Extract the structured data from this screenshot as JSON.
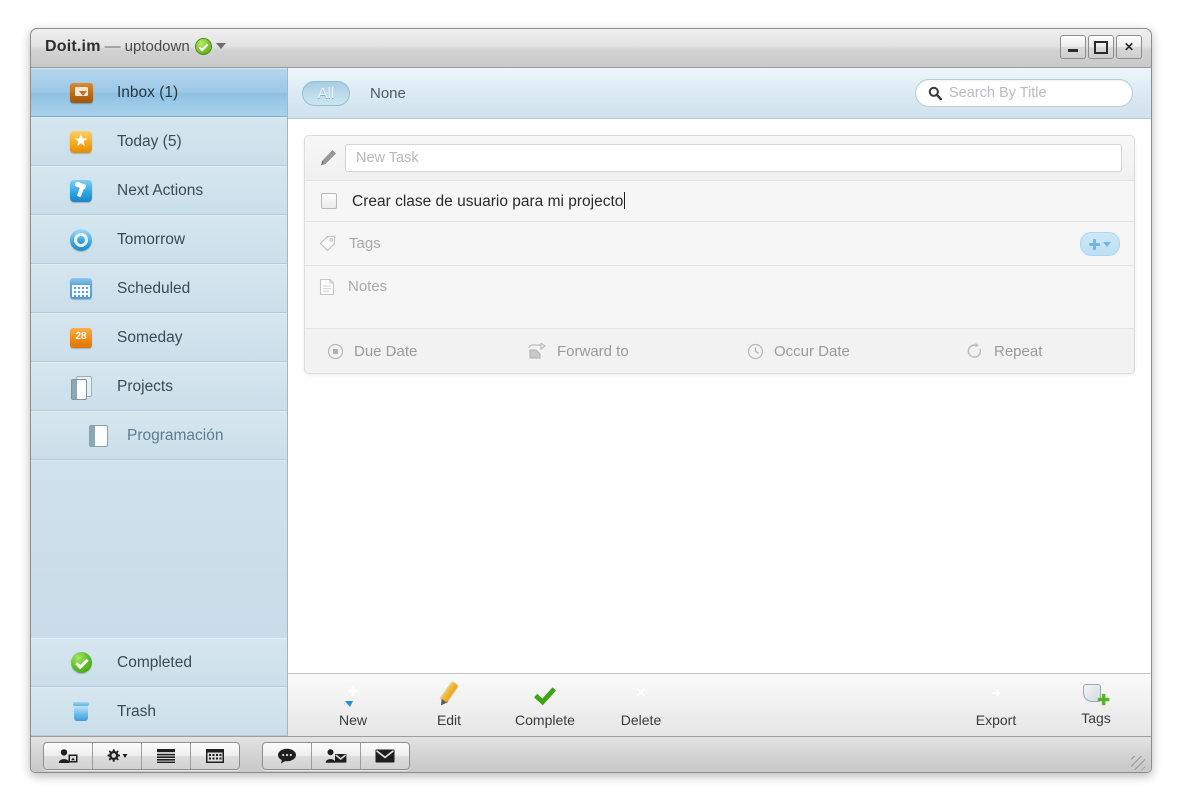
{
  "window": {
    "app_name": "Doit.im",
    "separator": "—",
    "account": "uptodown",
    "status_icon": "online-check-icon",
    "account_caret": "caret-down-icon",
    "controls": {
      "minimize": "minimize-icon",
      "maximize": "maximize-icon",
      "close": "✕"
    }
  },
  "sidebar": {
    "items": [
      {
        "label": "Inbox (1)",
        "icon": "inbox-icon",
        "selected": true
      },
      {
        "label": "Today (5)",
        "icon": "star-icon",
        "selected": false
      },
      {
        "label": "Next Actions",
        "icon": "pin-icon",
        "selected": false
      },
      {
        "label": "Tomorrow",
        "icon": "circle-icon",
        "selected": false
      },
      {
        "label": "Scheduled",
        "icon": "calendar-icon",
        "selected": false
      },
      {
        "label": "Someday",
        "icon": "folder-28-icon",
        "selected": false
      },
      {
        "label": "Projects",
        "icon": "projects-icon",
        "selected": false
      }
    ],
    "sub_items": [
      {
        "label": "Programación",
        "icon": "book-icon"
      }
    ],
    "bottom_items": [
      {
        "label": "Completed",
        "icon": "check-circle-icon"
      },
      {
        "label": "Trash",
        "icon": "trash-icon"
      }
    ]
  },
  "header": {
    "filters": [
      {
        "label": "All",
        "active": true
      },
      {
        "label": "None",
        "active": false
      }
    ],
    "search": {
      "icon": "search-icon",
      "placeholder": "Search By Title",
      "value": ""
    }
  },
  "editor": {
    "new_task": {
      "icon": "pencil-icon",
      "placeholder": "New Task",
      "value": ""
    },
    "task": {
      "checkbox_checked": false,
      "title": "Crear clase de usuario para mi projecto"
    },
    "tags": {
      "icon": "tag-icon",
      "label": "Tags",
      "add_button": "add-tag-button"
    },
    "notes": {
      "icon": "note-icon",
      "label": "Notes"
    },
    "meta": [
      {
        "label": "Due Date",
        "icon": "due-date-icon"
      },
      {
        "label": "Forward to",
        "icon": "forward-icon"
      },
      {
        "label": "Occur Date",
        "icon": "clock-icon"
      },
      {
        "label": "Repeat",
        "icon": "repeat-icon"
      }
    ]
  },
  "action_bar": {
    "left": [
      {
        "label": "New",
        "icon": "new-icon"
      },
      {
        "label": "Edit",
        "icon": "edit-pencil-icon"
      },
      {
        "label": "Complete",
        "icon": "check-icon"
      },
      {
        "label": "Delete",
        "icon": "delete-icon"
      }
    ],
    "right": [
      {
        "label": "Export",
        "icon": "export-icon"
      },
      {
        "label": "Tags",
        "icon": "add-tag-icon"
      }
    ]
  },
  "status_bar": {
    "group_one": [
      {
        "icon": "user-avatar-icon"
      },
      {
        "icon": "gear-dropdown-icon"
      },
      {
        "icon": "list-view-icon"
      },
      {
        "icon": "grid-view-icon"
      }
    ],
    "group_two": [
      {
        "icon": "chat-bubble-icon"
      },
      {
        "icon": "user-mail-icon"
      },
      {
        "icon": "envelope-icon"
      }
    ],
    "resize_grip": "resize-grip-icon"
  },
  "colors": {
    "sidebar_bg": "#cfe0ea",
    "sidebar_selected": "#9cc8e6",
    "accent_blue": "#2f9ee2",
    "accent_green": "#63c22a",
    "accent_orange": "#f09518",
    "accent_red": "#dd5223"
  }
}
